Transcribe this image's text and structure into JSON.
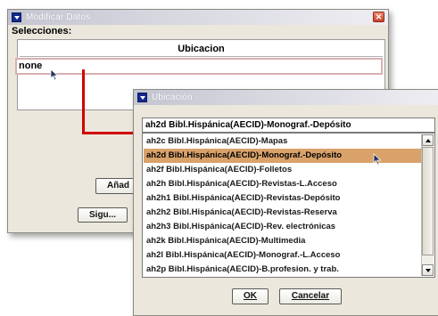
{
  "main_window": {
    "title": "Modificar Datos",
    "selecciones_label": "Selecciones:",
    "column_header": "Ubicacion",
    "row_value": "none",
    "add_button_label": "Añad",
    "next_button_label": "Sigu..."
  },
  "ubicacion_dialog": {
    "title": "Ubicación",
    "combo_value": "ah2d   Bibl.Hispánica(AECID)-Monograf.-Depósito",
    "list_items": [
      "ah2c   Bibl.Hispánica(AECID)-Mapas",
      "ah2d   Bibl.Hispánica(AECID)-Monograf.-Depósito",
      "ah2f   Bibl.Hispánica(AECID)-Folletos",
      "ah2h   Bibl.Hispánica(AECID)-Revistas-L.Acceso",
      "ah2h1  Bibl.Hispánica(AECID)-Revistas-Depósito",
      "ah2h2  Bibl.Hispánica(AECID)-Revistas-Reserva",
      "ah2h3  Bibl.Hispánica(AECID)-Rev. electrónicas",
      "ah2k   Bibl.Hispánica(AECID)-Multimedia",
      "ah2l   Bibl.Hispánica(AECID)-Monograf.-L.Acceso",
      "ah2p   Bibl.Hispánica(AECID)-B.profesion. y trab."
    ],
    "selected_index": 1,
    "ok_label": "OK",
    "cancel_label": "Cancelar"
  },
  "colors": {
    "selection": "#d9a26a",
    "connector_line": "#d10000",
    "window_bg": "#ebe7dc"
  },
  "icons": [
    "window-icon",
    "close-icon",
    "scroll-up-icon",
    "scroll-down-icon",
    "mouse-pointer-icon"
  ]
}
